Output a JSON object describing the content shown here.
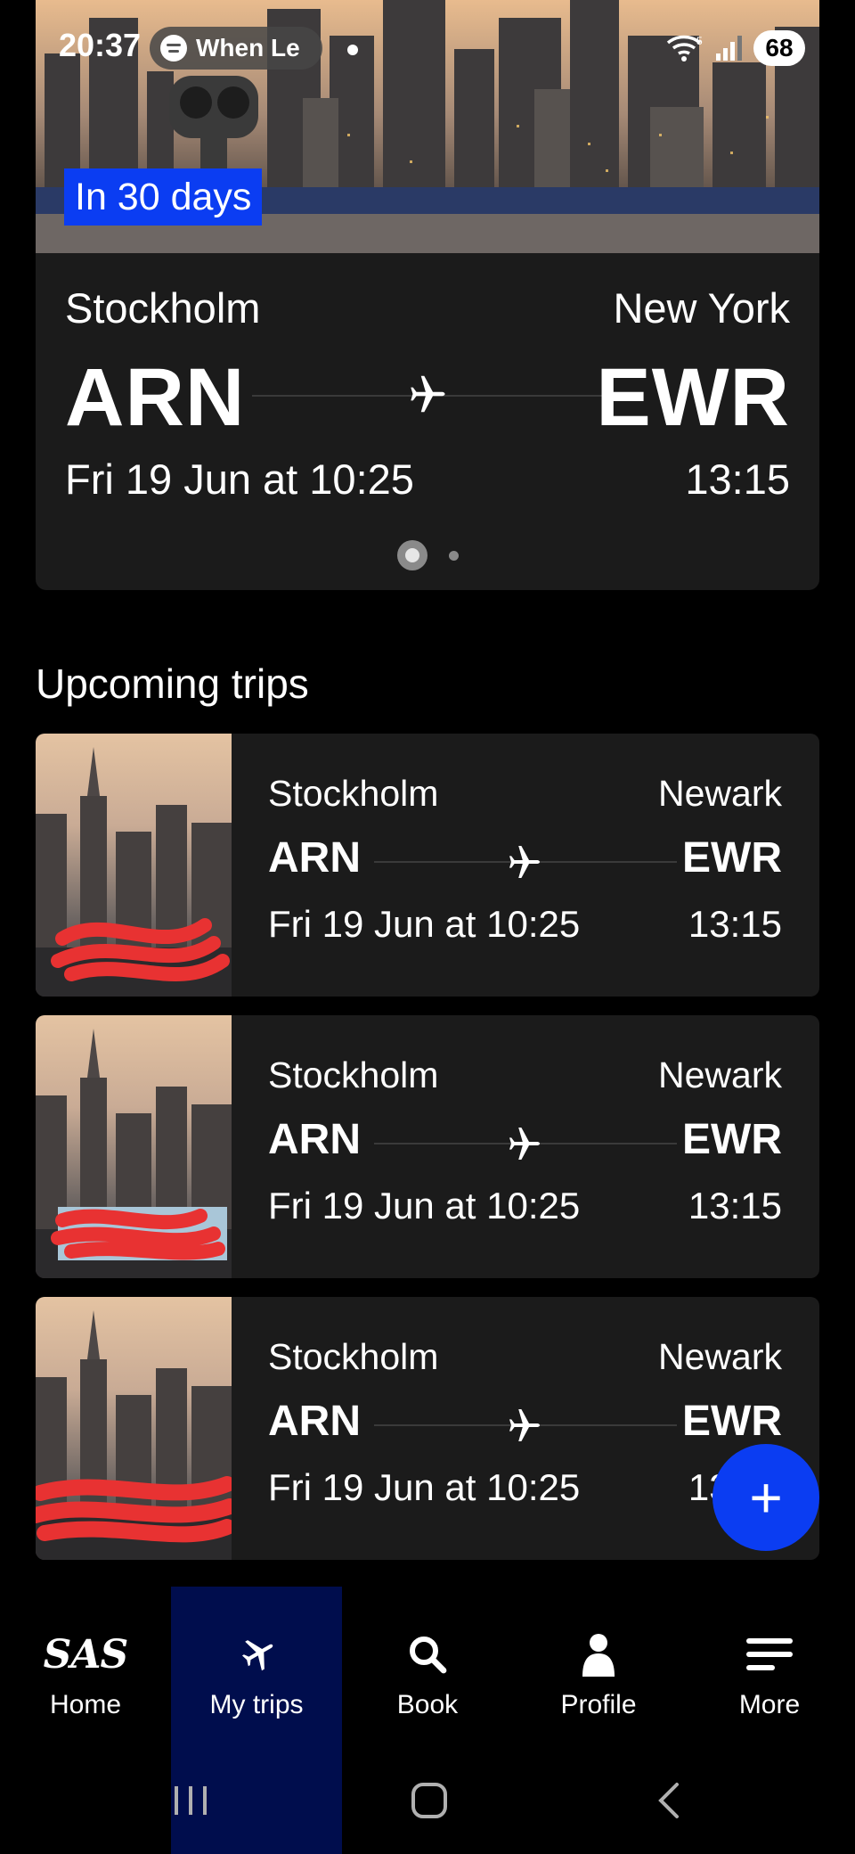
{
  "status_bar": {
    "time": "20:37",
    "media_text": "When Le",
    "battery": "68",
    "signal_label": "5"
  },
  "hero": {
    "badge": "In 30 days",
    "origin_city": "Stockholm",
    "destination_city": "New York",
    "origin_code": "ARN",
    "destination_code": "EWR",
    "departure": "Fri 19 Jun at 10:25",
    "arrival": "13:15",
    "page_indicator": {
      "total": 2,
      "active": 1
    }
  },
  "upcoming": {
    "title": "Upcoming trips",
    "trips": [
      {
        "origin_city": "Stockholm",
        "destination_city": "Newark",
        "origin_code": "ARN",
        "destination_code": "EWR",
        "departure": "Fri 19 Jun at 10:25",
        "arrival": "13:15"
      },
      {
        "origin_city": "Stockholm",
        "destination_city": "Newark",
        "origin_code": "ARN",
        "destination_code": "EWR",
        "departure": "Fri 19 Jun at 10:25",
        "arrival": "13:15"
      },
      {
        "origin_city": "Stockholm",
        "destination_city": "Newark",
        "origin_code": "ARN",
        "destination_code": "EWR",
        "departure": "Fri 19 Jun at 10:25",
        "arrival": "13:15"
      }
    ]
  },
  "fab": {
    "icon": "plus-icon",
    "label": "+"
  },
  "nav": {
    "items": [
      {
        "label": "Home",
        "icon": "sas-logo-icon",
        "logo_text": "SAS",
        "active": false
      },
      {
        "label": "My trips",
        "icon": "airplane-icon",
        "active": true
      },
      {
        "label": "Book",
        "icon": "search-icon",
        "active": false
      },
      {
        "label": "Profile",
        "icon": "person-icon",
        "active": false
      },
      {
        "label": "More",
        "icon": "menu-icon",
        "active": false
      }
    ]
  },
  "system_nav": {
    "buttons": [
      "recents-icon",
      "home-icon",
      "back-icon"
    ]
  },
  "colors": {
    "accent_blue": "#0b3df2",
    "active_nav": "#000d4d",
    "card_bg": "#1b1b1b",
    "redaction": "#e83232"
  }
}
